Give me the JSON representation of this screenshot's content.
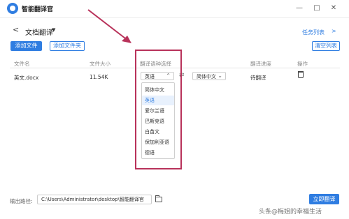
{
  "app": {
    "title": "智能翻译官"
  },
  "window_controls": {
    "minimize": "—",
    "maximize": "□",
    "close": "✕"
  },
  "header": {
    "back": "<",
    "title": "文档翻译",
    "caret": "▼",
    "task_list": "任务列表",
    "task_arrow": ">"
  },
  "toolbar": {
    "add_file": "添加文件",
    "add_folder": "添加文件夹",
    "clear_list": "清空列表"
  },
  "table": {
    "headers": [
      "文件名",
      "文件大小",
      "翻译语种选择",
      "翻译进度",
      "操作"
    ],
    "rows": [
      {
        "name": "英文.docx",
        "size": "11.54K",
        "source_lang": "英语",
        "target_lang": "简体中文",
        "status": "待翻译"
      }
    ]
  },
  "language_dropdown": {
    "selected": "英语",
    "options": [
      "简体中文",
      "英语",
      "爱尔兰语",
      "巴斯克语",
      "白苗文",
      "保加利亚语",
      "德语"
    ]
  },
  "footer": {
    "output_label": "输出路径:",
    "output_path": "C:\\Users\\Administrator\\desktop\\智能翻译官",
    "translate_now": "立即翻译"
  },
  "watermark": "头条@梅姐的幸福生活",
  "colors": {
    "accent": "#2f7de1",
    "annotation": "#b8325a"
  }
}
